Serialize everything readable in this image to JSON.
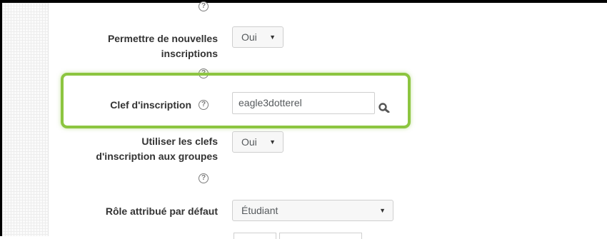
{
  "form": {
    "permettre": {
      "label_line1": "Permettre de nouvelles",
      "label_line2": "inscriptions",
      "value": "Oui"
    },
    "clef": {
      "label": "Clef d'inscription",
      "value": "eagle3dotterel"
    },
    "clefs_groupes": {
      "label_line1": "Utiliser les clefs",
      "label_line2": "d'inscription aux groupes",
      "value": "Oui"
    },
    "role": {
      "label": "Rôle attribué par défaut",
      "value": "Étudiant"
    }
  },
  "icons": {
    "help": "question-circle-icon",
    "reveal": "search-icon",
    "dropdown": "caret-down-icon"
  },
  "colors": {
    "highlight": "#8cc540",
    "label": "#333333",
    "input_text": "#55595c"
  }
}
